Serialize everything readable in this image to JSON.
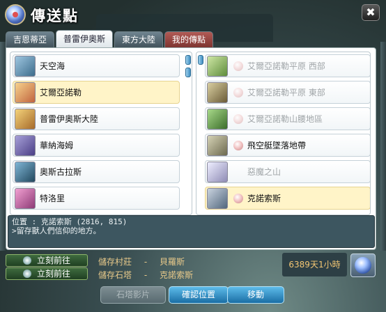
{
  "window": {
    "title": "傳送點"
  },
  "tabs": [
    {
      "label": "吉恩蒂亞",
      "active": false
    },
    {
      "label": "普雷伊奧斯",
      "active": true
    },
    {
      "label": "東方大陸",
      "active": false
    },
    {
      "label": "我的傳點",
      "active": false
    }
  ],
  "left_list": [
    {
      "label": "天空海",
      "icon": "sky-sea-icon",
      "color": "#3d6d8c",
      "selected": false
    },
    {
      "label": "艾爾亞諾勒",
      "icon": "fairy-town-icon",
      "color": "#d8a05a",
      "selected": true
    },
    {
      "label": "普雷伊奧斯大陸",
      "icon": "continent-icon",
      "color": "#c79142",
      "selected": false
    },
    {
      "label": "華納海姆",
      "icon": "vanaheim-icon",
      "color": "#6b5ea8",
      "selected": false
    },
    {
      "label": "奧斯古拉斯",
      "icon": "osgulas-icon",
      "color": "#3a7a9a",
      "selected": false
    },
    {
      "label": "特洛里",
      "icon": "trolli-icon",
      "color": "#c4569a",
      "selected": false
    }
  ],
  "right_list": [
    {
      "label": "艾爾亞諾勒平原 西部",
      "icon": "plant-monster-icon",
      "color": "#5f8d3c",
      "dim": true,
      "selected": false
    },
    {
      "label": "艾爾亞諾勒平原 東部",
      "icon": "totem-icon",
      "color": "#8c7a4f",
      "dim": true,
      "selected": false
    },
    {
      "label": "艾爾亞諾勒山腰地區",
      "icon": "tree-monster-icon",
      "color": "#4d8a3a",
      "dim": true,
      "selected": false
    },
    {
      "label": "飛空艇墜落地帶",
      "icon": "golem-icon",
      "color": "#8e8a6a",
      "dim": false,
      "selected": false
    },
    {
      "label": "惡魔之山",
      "icon": "ghost-icon",
      "color": "#a7a4c7",
      "dim": true,
      "selected": false
    },
    {
      "label": "克諾索斯",
      "icon": "statue-icon",
      "color": "#6a7f95",
      "dim": false,
      "selected": true
    }
  ],
  "info": {
    "line1": "位置 : 克諾索斯 (2816, 815)",
    "line2": ">留存獸人們信仰的地方。"
  },
  "bottom": {
    "go_label": "立刻前往",
    "save_village_key": "儲存村莊",
    "save_village_value": "貝羅斯",
    "save_stone_key": "儲存石塔",
    "save_stone_value": "克諾索斯",
    "dash": "-",
    "time_left": "6389天1小時"
  },
  "buttons": {
    "stone_image": "石塔影片",
    "confirm": "確認位置",
    "move": "移動"
  },
  "colors": {
    "tab_active": "#ffffff",
    "tab_mine": "#9a4642",
    "selected_row": "#fff4c8",
    "info_bg": "#3d5660",
    "time_text": "#f3c673",
    "button_blue": "#2b8ac3"
  }
}
